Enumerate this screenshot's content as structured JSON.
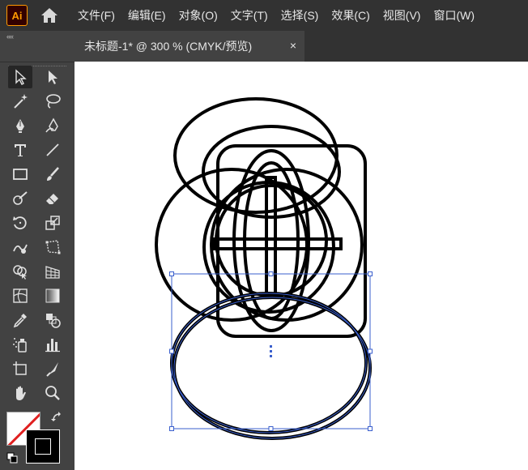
{
  "app": {
    "logo_text": "Ai",
    "logo_colors": {
      "background": "#330000",
      "accent": "#ff9a00"
    },
    "home_icon": "home-icon"
  },
  "menu": [
    {
      "label": "文件(F)"
    },
    {
      "label": "编辑(E)"
    },
    {
      "label": "对象(O)"
    },
    {
      "label": "文字(T)"
    },
    {
      "label": "选择(S)"
    },
    {
      "label": "效果(C)"
    },
    {
      "label": "视图(V)"
    },
    {
      "label": "窗口(W)"
    }
  ],
  "document_tab": {
    "title": "未标题-1* @ 300 % (CMYK/预览)",
    "close_label": "×"
  },
  "panel": {
    "collapse_label": "««"
  },
  "tools": [
    {
      "name": "selection-tool",
      "icon": "arrow-icon",
      "active": true
    },
    {
      "name": "direct-selection-tool",
      "icon": "white-arrow-icon",
      "active": false
    },
    {
      "name": "magic-wand-tool",
      "icon": "magic-wand-icon",
      "active": false
    },
    {
      "name": "lasso-tool",
      "icon": "lasso-icon",
      "active": false
    },
    {
      "name": "pen-tool",
      "icon": "pen-icon",
      "active": false
    },
    {
      "name": "curvature-tool",
      "icon": "curvature-pen-icon",
      "active": false
    },
    {
      "name": "type-tool",
      "icon": "type-icon",
      "active": false
    },
    {
      "name": "line-segment-tool",
      "icon": "line-icon",
      "active": false
    },
    {
      "name": "rectangle-tool",
      "icon": "rectangle-icon",
      "active": false
    },
    {
      "name": "paintbrush-tool",
      "icon": "brush-icon",
      "active": false
    },
    {
      "name": "shaper-tool",
      "icon": "shaper-icon",
      "active": false
    },
    {
      "name": "eraser-tool",
      "icon": "eraser-icon",
      "active": false
    },
    {
      "name": "rotate-tool",
      "icon": "rotate-icon",
      "active": false
    },
    {
      "name": "scale-tool",
      "icon": "scale-icon",
      "active": false
    },
    {
      "name": "warp-tool",
      "icon": "warp-icon",
      "active": false
    },
    {
      "name": "free-transform-tool",
      "icon": "free-transform-icon",
      "active": false
    },
    {
      "name": "shape-builder-tool",
      "icon": "shape-builder-icon",
      "active": false
    },
    {
      "name": "perspective-grid-tool",
      "icon": "perspective-grid-icon",
      "active": false
    },
    {
      "name": "mesh-tool",
      "icon": "mesh-icon",
      "active": false
    },
    {
      "name": "gradient-tool",
      "icon": "gradient-icon",
      "active": false
    },
    {
      "name": "eyedropper-tool",
      "icon": "eyedropper-icon",
      "active": false
    },
    {
      "name": "blend-tool",
      "icon": "blend-icon",
      "active": false
    },
    {
      "name": "symbol-sprayer-tool",
      "icon": "symbol-sprayer-icon",
      "active": false
    },
    {
      "name": "column-graph-tool",
      "icon": "column-graph-icon",
      "active": false
    },
    {
      "name": "artboard-tool",
      "icon": "artboard-icon",
      "active": false
    },
    {
      "name": "slice-tool",
      "icon": "slice-icon",
      "active": false
    },
    {
      "name": "hand-tool",
      "icon": "hand-icon",
      "active": false
    },
    {
      "name": "zoom-tool",
      "icon": "zoom-icon",
      "active": false
    }
  ],
  "colors": {
    "fill": "none",
    "stroke": "#000000",
    "selection": "#3a5fcd",
    "ui_dark": "#323232",
    "ui_panel": "#424242",
    "ui_bg": "#535353"
  }
}
